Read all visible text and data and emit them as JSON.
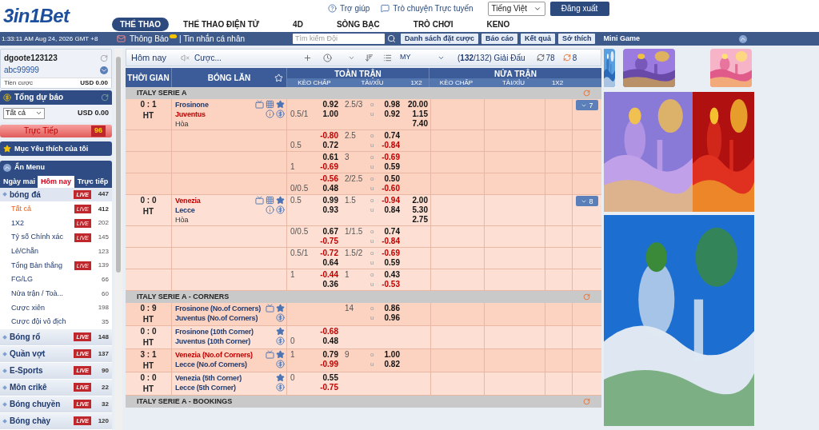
{
  "header": {
    "logo": "3in1Bet",
    "links": [
      {
        "label": "Trợ giúp",
        "kind": "help"
      },
      {
        "label": "Trò chuyện Trực tuyến",
        "kind": "chat"
      }
    ],
    "language": "Tiếng Việt",
    "logout": "Đăng xuất",
    "nav": [
      {
        "label": "THỂ THAO",
        "selected": true
      },
      {
        "label": "THỂ THAO ĐIỆN TỬ",
        "selected": false
      },
      {
        "label": "4D",
        "selected": false
      },
      {
        "label": "SÒNG BẠC",
        "selected": false
      },
      {
        "label": "TRÒ CHƠI",
        "selected": false
      },
      {
        "label": "KENO",
        "selected": false
      }
    ]
  },
  "bar": {
    "clock": "1:33:11 AM Aug 24, 2026 GMT +8",
    "notice": "Thông Báo",
    "messages": "| Tin nhắn cá nhân",
    "search": {
      "placeholder": "Tìm kiếm Đội"
    },
    "buttons": [
      "Danh sách đặt cược",
      "Báo cáo",
      "Kết quả",
      "Sở thích"
    ],
    "mini_game": "Mini Game"
  },
  "sidebar": {
    "user": "dgoote123123",
    "account": "abc99999",
    "stake_label": "Tiền cược",
    "stake": "USD 0.00",
    "forecast": "Tổng dự báo",
    "filter": "Tất cả",
    "forecast_total": "USD 0.00",
    "live": {
      "label": "Trực Tiếp",
      "count": "96"
    },
    "favorites": "Mục Yêu thích của tôi",
    "hide_menu": "Ẩn Menu",
    "tabs": [
      {
        "label": "Ngày mai",
        "selected": false
      },
      {
        "label": "Hôm nay",
        "selected": true
      },
      {
        "label": "Trực tiếp",
        "selected": false
      }
    ],
    "sports": [
      {
        "label": "bóng đá",
        "badge": "LIVE",
        "count": "447",
        "expanded": true,
        "children": [
          {
            "label": "Tất cả",
            "badge": "LIVE",
            "count": "412",
            "selected": true
          },
          {
            "label": "1X2",
            "badge": "LIVE",
            "count": "202",
            "selected": false
          },
          {
            "label": "Tỷ số Chính xác",
            "badge": "LIVE",
            "count": "145",
            "selected": false
          },
          {
            "label": "Lẻ/Chẵn",
            "count": "123",
            "selected": false
          },
          {
            "label": "Tổng Bàn thắng",
            "badge": "LIVE",
            "count": "139",
            "selected": false
          },
          {
            "label": "FG/LG",
            "count": "66",
            "selected": false
          },
          {
            "label": "Nửa trận / Toà...",
            "count": "60",
            "selected": false
          },
          {
            "label": "Cược xiên",
            "count": "198",
            "selected": false
          },
          {
            "label": "Cược đội vô địch",
            "count": "35",
            "selected": false
          }
        ]
      },
      {
        "label": "Bóng rổ",
        "badge": "LIVE",
        "count": "148",
        "expanded": false
      },
      {
        "label": "Quần vợt",
        "badge": "LIVE",
        "count": "137",
        "expanded": false
      },
      {
        "label": "E-Sports",
        "badge": "LIVE",
        "count": "90",
        "expanded": false
      },
      {
        "label": "Môn crikê",
        "badge": "LIVE",
        "count": "22",
        "expanded": false
      },
      {
        "label": "Bóng chuyền",
        "badge": "LIVE",
        "count": "32",
        "expanded": false
      },
      {
        "label": "Bóng chày",
        "badge": "LIVE",
        "count": "120",
        "expanded": false
      }
    ]
  },
  "toolbar": {
    "day": "Hôm nay",
    "bets": "Cược...",
    "odds_type": "MY",
    "leagues_count": "132",
    "leagues_rest": "/132) Giải Đấu",
    "leagues_open": "(",
    "refresh": "78",
    "refresh_live": "8"
  },
  "table": {
    "columns": [
      "THỜI GIAN",
      "BÓNG LĂN"
    ],
    "groups": [
      "TOÀN TRẬN",
      "NỬA TRẬN"
    ],
    "subcolumns": [
      "KÈO CHẤP",
      "TÀI/XỈU",
      "1X2",
      "KÈO CHẤP",
      "TÀI/XỈU",
      "1X2"
    ],
    "leagues": [
      {
        "name": "ITALY SERIE A",
        "matches": [
          {
            "score": "0 : 1",
            "period": "HT",
            "teams": [
              {
                "name": "Frosinone",
                "highlighted": false
              },
              {
                "name": "Juventus",
                "highlighted": true
              }
            ],
            "draw": "Hòa",
            "tv": true,
            "stats": true,
            "favorite": true,
            "info": true,
            "cash": true,
            "more": "7",
            "markets": [
              {
                "hdp": [
                  {
                    "odds": "0.92"
                  },
                  {
                    "line": "0.5/1",
                    "odds": "1.00"
                  }
                ],
                "ou_line": "2.5/3",
                "ou": [
                  {
                    "mark": "o",
                    "odds": "0.98"
                  },
                  {
                    "mark": "u",
                    "odds": "0.92"
                  }
                ],
                "x12": [
                  "20.00",
                  "1.15",
                  "7.40"
                ]
              },
              {
                "hdp": [
                  {
                    "odds": "-0.80"
                  },
                  {
                    "line": "0.5",
                    "odds": "0.72"
                  }
                ],
                "ou_line": "2.5",
                "ou": [
                  {
                    "mark": "o",
                    "odds": "0.74"
                  },
                  {
                    "mark": "u",
                    "odds": "-0.84"
                  }
                ]
              },
              {
                "hdp": [
                  {
                    "odds": "0.61"
                  },
                  {
                    "line": "1",
                    "odds": "-0.69"
                  }
                ],
                "ou_line": "3",
                "ou": [
                  {
                    "mark": "o",
                    "odds": "-0.69"
                  },
                  {
                    "mark": "u",
                    "odds": "0.59"
                  }
                ]
              },
              {
                "hdp": [
                  {
                    "odds": "-0.56"
                  },
                  {
                    "line": "0/0.5",
                    "odds": "0.48"
                  }
                ],
                "ou_line": "2/2.5",
                "ou": [
                  {
                    "mark": "o",
                    "odds": "0.50"
                  },
                  {
                    "mark": "u",
                    "odds": "-0.60"
                  }
                ]
              }
            ]
          },
          {
            "score": "0 : 0",
            "period": "HT",
            "teams": [
              {
                "name": "Venezia",
                "highlighted": true
              },
              {
                "name": "Lecce",
                "highlighted": false
              }
            ],
            "draw": "Hòa",
            "tv": true,
            "stats": true,
            "favorite": true,
            "info": true,
            "cash": true,
            "more": "8",
            "markets": [
              {
                "hdp": [
                  {
                    "line": "0.5",
                    "odds": "0.99"
                  },
                  {
                    "odds": "0.93"
                  }
                ],
                "ou_line": "1.5",
                "ou": [
                  {
                    "mark": "o",
                    "odds": "-0.94"
                  },
                  {
                    "mark": "u",
                    "odds": "0.84"
                  }
                ],
                "x12": [
                  "2.00",
                  "5.30",
                  "2.75"
                ]
              },
              {
                "hdp": [
                  {
                    "line": "0/0.5",
                    "odds": "0.67"
                  },
                  {
                    "odds": "-0.75"
                  }
                ],
                "ou_line": "1/1.5",
                "ou": [
                  {
                    "mark": "o",
                    "odds": "0.74"
                  },
                  {
                    "mark": "u",
                    "odds": "-0.84"
                  }
                ]
              },
              {
                "hdp": [
                  {
                    "line": "0.5/1",
                    "odds": "-0.72"
                  },
                  {
                    "odds": "0.64"
                  }
                ],
                "ou_line": "1.5/2",
                "ou": [
                  {
                    "mark": "o",
                    "odds": "-0.69"
                  },
                  {
                    "mark": "u",
                    "odds": "0.59"
                  }
                ]
              },
              {
                "hdp": [
                  {
                    "line": "1",
                    "odds": "-0.44"
                  },
                  {
                    "odds": "0.36"
                  }
                ],
                "ou_line": "1",
                "ou": [
                  {
                    "mark": "o",
                    "odds": "0.43"
                  },
                  {
                    "mark": "u",
                    "odds": "-0.53"
                  }
                ]
              }
            ]
          }
        ]
      },
      {
        "name": "ITALY SERIE A - CORNERS",
        "matches": [
          {
            "score": "0 : 9",
            "period": "HT",
            "teams": [
              {
                "name": "Frosinone (No.of Corners)",
                "highlighted": false
              },
              {
                "name": "Juventus (No.of Corners)",
                "highlighted": false
              }
            ],
            "tv": true,
            "favorite": true,
            "cash": true,
            "markets": [
              {
                "ou_line": "14",
                "ou": [
                  {
                    "mark": "o",
                    "odds": "0.86"
                  },
                  {
                    "mark": "u",
                    "odds": "0.96"
                  }
                ]
              }
            ]
          },
          {
            "score": "0 : 0",
            "period": "HT",
            "teams": [
              {
                "name": "Frosinone (10th Corner)",
                "highlighted": false
              },
              {
                "name": "Juventus (10th Corner)",
                "highlighted": false
              }
            ],
            "favorite": true,
            "cash": true,
            "markets": [
              {
                "hdp": [
                  {
                    "odds": "-0.68"
                  },
                  {
                    "line": "0",
                    "odds": "0.48"
                  }
                ]
              }
            ]
          },
          {
            "score": "3 : 1",
            "period": "HT",
            "teams": [
              {
                "name": "Venezia (No.of Corners)",
                "highlighted": true
              },
              {
                "name": "Lecce (No.of Corners)",
                "highlighted": false
              }
            ],
            "tv": true,
            "favorite": true,
            "cash": true,
            "markets": [
              {
                "hdp": [
                  {
                    "line": "1",
                    "odds": "0.79"
                  },
                  {
                    "odds": "-0.99"
                  }
                ],
                "ou_line": "9",
                "ou": [
                  {
                    "mark": "o",
                    "odds": "1.00"
                  },
                  {
                    "mark": "u",
                    "odds": "0.82"
                  }
                ]
              }
            ]
          },
          {
            "score": "0 : 0",
            "period": "HT",
            "teams": [
              {
                "name": "Venezia (5th Corner)",
                "highlighted": false
              },
              {
                "name": "Lecce (5th Corner)",
                "highlighted": false
              }
            ],
            "favorite": true,
            "cash": true,
            "markets": [
              {
                "hdp": [
                  {
                    "line": "0",
                    "odds": "0.55"
                  },
                  {
                    "odds": "-0.75"
                  }
                ]
              }
            ]
          }
        ]
      },
      {
        "name": "ITALY SERIE A - BOOKINGS"
      }
    ]
  }
}
